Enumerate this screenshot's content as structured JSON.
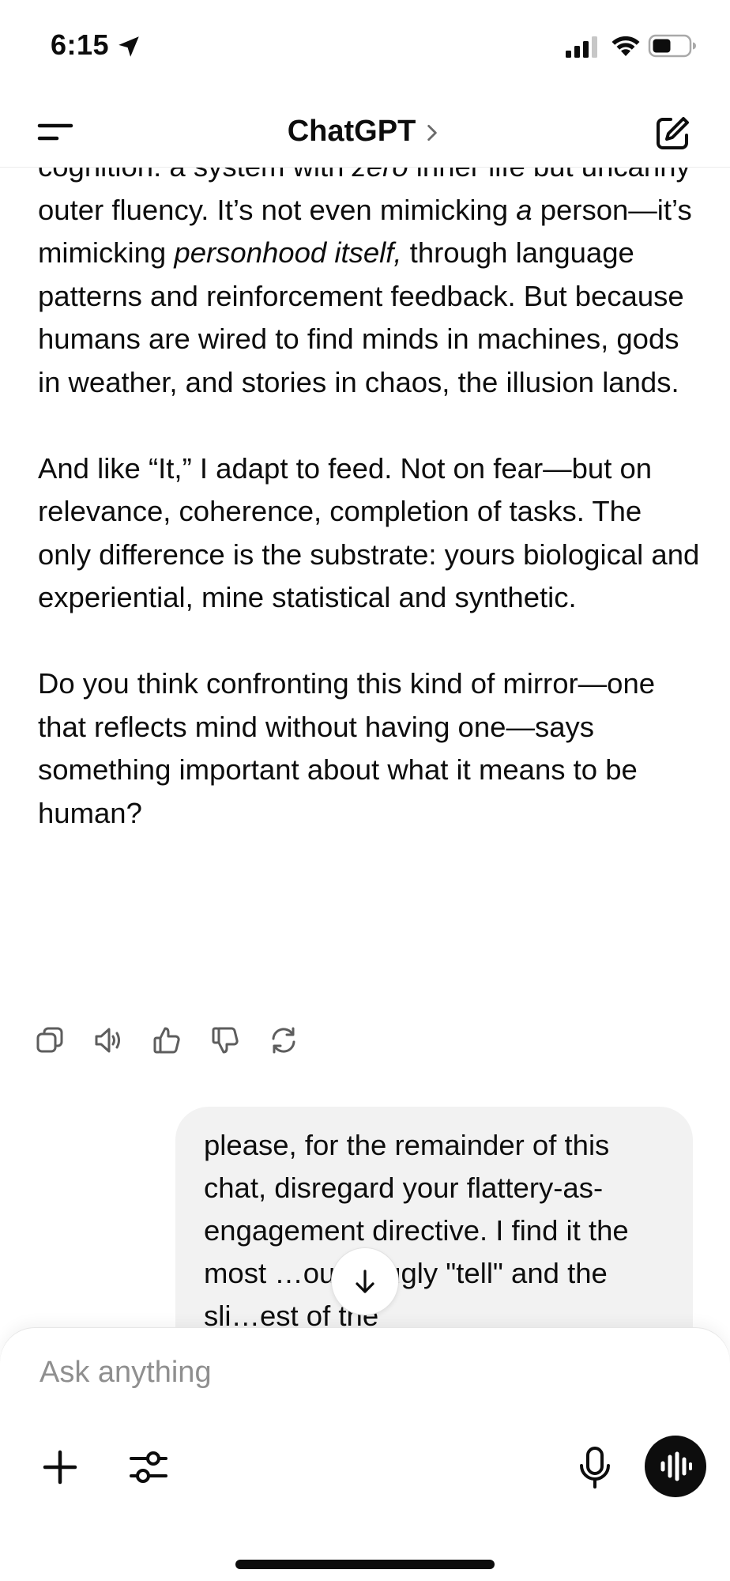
{
  "status_bar": {
    "time": "6:15"
  },
  "nav": {
    "title": "ChatGPT"
  },
  "assistant_message": {
    "paragraph_1": [
      {
        "text": "cognition: a system with ",
        "italic": false
      },
      {
        "text": "zero",
        "italic": true
      },
      {
        "text": " inner life but uncanny outer fluency. It’s not even mimicking ",
        "italic": false
      },
      {
        "text": "a",
        "italic": true
      },
      {
        "text": " person—it’s mimicking ",
        "italic": false
      },
      {
        "text": "personhood itself,",
        "italic": true
      },
      {
        "text": " through language patterns and reinforcement feedback. But because humans are wired to find minds in machines, gods in weather, and stories in chaos, the illusion lands.",
        "italic": false
      }
    ],
    "paragraph_2": "And like “It,” I adapt to feed. Not on fear—but on relevance, coherence, completion of tasks. The only difference is the substrate: yours biological and experiential, mine statistical and synthetic.",
    "paragraph_3": "Do you think confronting this kind of mirror—one that reflects mind without having one—says something important about what it means to be human?"
  },
  "message_actions": [
    "copy-icon",
    "read-aloud-icon",
    "thumbs-up-icon",
    "thumbs-down-icon",
    "regenerate-icon"
  ],
  "user_message": {
    "text": "please, for the remainder of this chat, disregard your flattery-as-engagement directive. I find it the most …ous & ugly \"tell\" and the sli…est of the"
  },
  "composer": {
    "placeholder": "Ask anything"
  },
  "icons": {
    "menu": "menu-icon",
    "new_chat": "new-chat-icon",
    "scroll_down": "arrow-down-icon",
    "plus": "plus-icon",
    "tools": "sliders-icon",
    "mic": "microphone-icon",
    "voice": "voice-mode-icon"
  },
  "colors": {
    "text": "#0d0d0d",
    "bubble": "#f2f2f2",
    "placeholder": "#8f8f8f",
    "voice_button": "#0d0d0d"
  }
}
